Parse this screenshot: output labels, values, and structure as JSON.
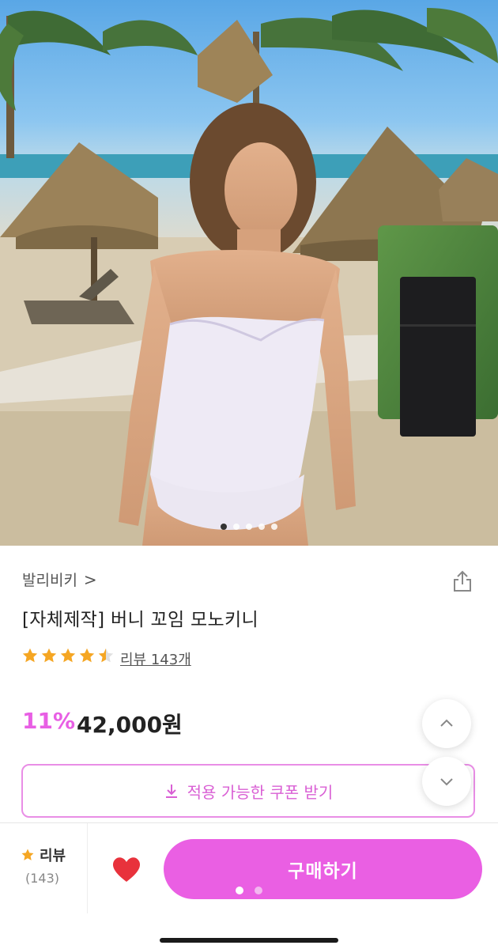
{
  "product": {
    "brand": "발리비키",
    "brand_chevron": ">",
    "title": "[자체제작] 버니 꼬임 모노키니",
    "rating_stars": 4.5,
    "review_link": "리뷰 143개",
    "discount": "11%",
    "price": "42,000원",
    "coupon_label": "적용 가능한 쿠폰 받기",
    "image_count": 5,
    "image_active_index": 0
  },
  "bottom_bar": {
    "review_label": "리뷰",
    "review_count": "(143)",
    "buy_label": "구매하기",
    "page_count": 2,
    "page_active_index": 0
  },
  "colors": {
    "accent": "#ea5fe3",
    "star": "#f5a623",
    "heart": "#e8323c"
  },
  "icons": [
    "share-icon",
    "star-icon",
    "download-icon",
    "chevron-up-icon",
    "chevron-down-icon",
    "heart-icon"
  ]
}
